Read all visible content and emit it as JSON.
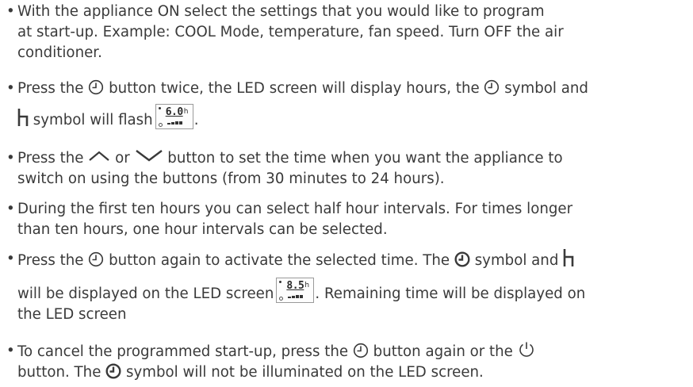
{
  "bullets": [
    {
      "lines": [
        "With the appliance ON select the settings that you would like to program",
        "at start-up. Example: COOL Mode, temperature, fan speed. Turn OFF the air",
        "conditioner."
      ]
    },
    {
      "l1_a": "Press the",
      "l1_b": "button twice, the LED screen will display hours,  the",
      "l1_c": "symbol and",
      "l2_a": "symbol will flash",
      "l2_b": ".",
      "lcd": {
        "digits": "6.0",
        "unit": "h"
      }
    },
    {
      "l1_a": "Press the",
      "l1_b": "or",
      "l1_c": "button to set the time when you want the appliance to",
      "l2": "switch on using the buttons (from 30 minutes to 24 hours)."
    },
    {
      "lines": [
        "During the first ten hours you can select half hour intervals. For times longer",
        "than ten hours, one hour intervals can be selected."
      ]
    },
    {
      "l1_a": "Press the",
      "l1_b": "button again to activate the selected time. The",
      "l1_c": "symbol and",
      "l2_a": "will be displayed on the LED screen",
      "l2_b": ". Remaining time will be displayed on",
      "l3": "the LED screen",
      "lcd": {
        "digits": "8.5",
        "unit": "h"
      }
    },
    {
      "l1_a": "To cancel the programmed start-up, press the",
      "l1_b": "button again or the",
      "l2_a": "button. The",
      "l2_b": "symbol will not be illuminated on the LED screen."
    }
  ],
  "icons": {
    "timer": "timer-icon",
    "timer_filled": "timer-filled-icon",
    "hours": "hour-symbol-icon",
    "up": "up-arrow-icon",
    "down": "down-arrow-icon",
    "power": "power-icon"
  }
}
